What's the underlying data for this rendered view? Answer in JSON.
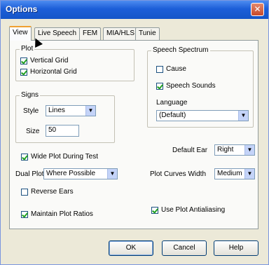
{
  "window": {
    "title": "Options",
    "close": "✕"
  },
  "tabs": [
    "View",
    "Live Speech",
    "FEM",
    "MIA/HLS",
    "Tunie"
  ],
  "plot": {
    "group_label": "Plot",
    "vertical_grid": "Vertical Grid",
    "horizontal_grid": "Horizontal Grid"
  },
  "signs": {
    "group_label": "Signs",
    "style_label": "Style",
    "style_value": "Lines",
    "size_label": "Size",
    "size_value": "50"
  },
  "spectrum": {
    "group_label": "Speech Spectrum",
    "cause": "Cause",
    "speech_sounds": "Speech Sounds",
    "language_label": "Language",
    "language_value": "(Default)"
  },
  "options": {
    "wide_plot": "Wide Plot During Test",
    "dual_plot_label": "Dual Plot",
    "dual_plot_value": "Where Possible",
    "reverse_ears": "Reverse Ears",
    "maintain_ratio": "Maintain Plot Ratios",
    "default_ear_label": "Default Ear",
    "default_ear_value": "Right",
    "curves_width_label": "Plot Curves Width",
    "curves_width_value": "Medium",
    "antialiasing": "Use Plot Antialiasing"
  },
  "buttons": {
    "ok": "OK",
    "cancel": "Cancel",
    "help": "Help"
  },
  "colors": {
    "titlebar": "#1c5ed8",
    "dialog_bg": "#ece9d8",
    "check": "#21a121"
  }
}
